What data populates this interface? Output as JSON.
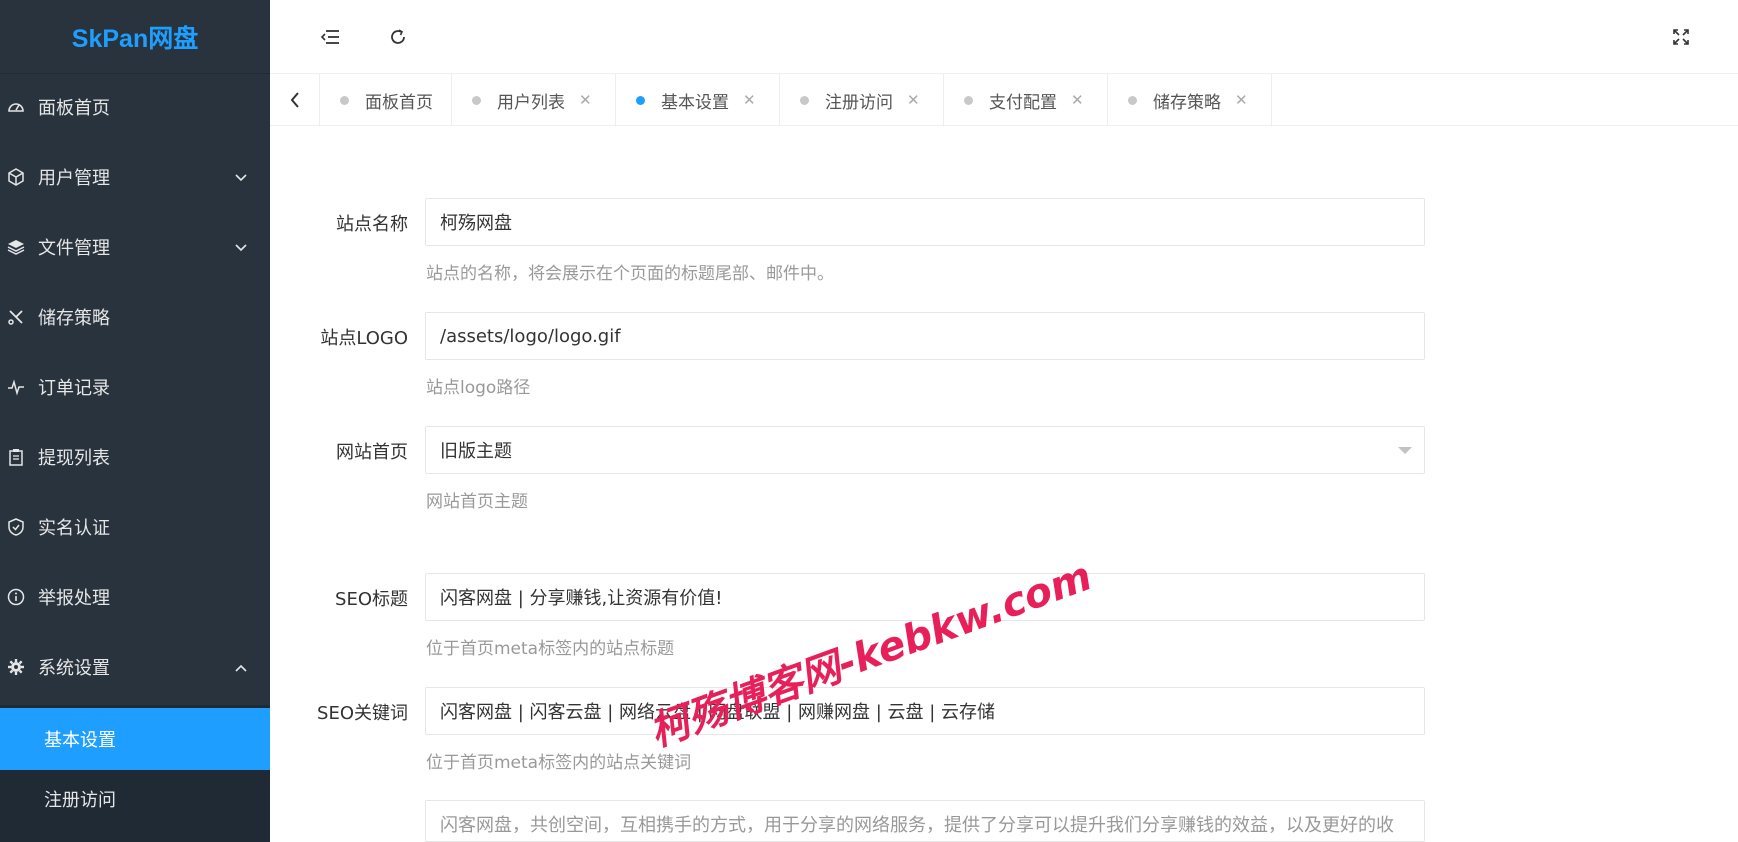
{
  "app": {
    "logo": "SkPan网盘"
  },
  "colors": {
    "accent": "#1e9fff",
    "sidebar_bg": "#28333e",
    "watermark": "#e8205a"
  },
  "sidebar": {
    "items": [
      {
        "label": "面板首页",
        "icon": "dashboard-icon"
      },
      {
        "label": "用户管理",
        "icon": "cube-icon",
        "expandable": true
      },
      {
        "label": "文件管理",
        "icon": "layers-icon",
        "expandable": true
      },
      {
        "label": "储存策略",
        "icon": "tools-icon"
      },
      {
        "label": "订单记录",
        "icon": "pulse-icon"
      },
      {
        "label": "提现列表",
        "icon": "clipboard-icon"
      },
      {
        "label": "实名认证",
        "icon": "shield-icon"
      },
      {
        "label": "举报处理",
        "icon": "info-icon"
      },
      {
        "label": "系统设置",
        "icon": "gear-icon",
        "expanded": true
      }
    ],
    "subitems": [
      {
        "label": "基本设置",
        "active": true
      },
      {
        "label": "注册访问",
        "active": false
      }
    ]
  },
  "header": {
    "menu_toggle_icon": "menu-fold-icon",
    "refresh_icon": "refresh-icon",
    "fullscreen_icon": "fullscreen-icon"
  },
  "tabs": [
    {
      "label": "面板首页",
      "closable": false,
      "active": false
    },
    {
      "label": "用户列表",
      "closable": true,
      "active": false
    },
    {
      "label": "基本设置",
      "closable": true,
      "active": true
    },
    {
      "label": "注册访问",
      "closable": true,
      "active": false
    },
    {
      "label": "支付配置",
      "closable": true,
      "active": false
    },
    {
      "label": "储存策略",
      "closable": true,
      "active": false
    }
  ],
  "form": {
    "site_name": {
      "label": "站点名称",
      "value": "柯殇网盘",
      "help": "站点的名称，将会展示在个页面的标题尾部、邮件中。"
    },
    "site_logo": {
      "label": "站点LOGO",
      "value": "/assets/logo/logo.gif",
      "help": "站点logo路径"
    },
    "homepage": {
      "label": "网站首页",
      "value": "旧版主题",
      "help": "网站首页主题"
    },
    "seo_title": {
      "label": "SEO标题",
      "value": "闪客网盘 | 分享赚钱,让资源有价值!",
      "help": "位于首页meta标签内的站点标题"
    },
    "seo_keywords": {
      "label": "SEO关键词",
      "value": "闪客网盘 | 闪客云盘 | 网络云盘 | 网盘联盟 | 网赚网盘 | 云盘 | 云存储",
      "help": "位于首页meta标签内的站点关键词"
    },
    "seo_description": {
      "value": "闪客网盘，共创空间，互相携手的方式，用于分享的网络服务，提供了分享可以提升我们分享赚钱的效益，以及更好的收益。"
    }
  },
  "watermark": "柯殇博客网-kebkw.com"
}
